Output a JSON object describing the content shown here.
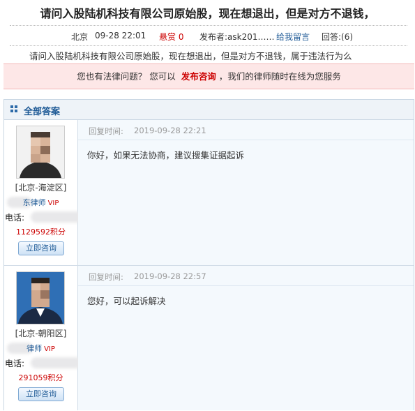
{
  "question": {
    "title": "请问入股陆机科技有限公司原始股，现在想退出，但是对方不退钱，",
    "location": "北京",
    "date": "09-28 22:01",
    "bounty": "悬赏 0",
    "publisher": "发布者:ask201……",
    "leave_message": "给我留言",
    "replies": "回答:(6)",
    "description": "请问入股陆机科技有限公司原始股，现在想退出，但是对方不退钱，属于违法行为么"
  },
  "banner": {
    "text_before": "您也有法律问题？  您可以",
    "action": "发布咨询",
    "text_after": "，我们的律师随时在线为您服务"
  },
  "answers_section": {
    "title": "全部答案",
    "items": [
      {
        "region": "[北京-海淀区]",
        "lawyer_suffix": "东律师",
        "vip": "VIP",
        "phone_label": "电话:",
        "points": "1129592积分",
        "consult_label": "立即咨询",
        "reply_label": "回复时间:",
        "reply_time": "2019-09-28 22:21",
        "reply_text": "你好，如果无法协商，建议搜集证据起诉"
      },
      {
        "region": "[北京-朝阳区]",
        "lawyer_suffix": "律师",
        "vip": "VIP",
        "phone_label": "电话:",
        "points": "291059积分",
        "consult_label": "立即咨询",
        "reply_label": "回复时间:",
        "reply_time": "2019-09-28 22:57",
        "reply_text": "您好，可以起诉解决"
      }
    ]
  },
  "colors": {
    "accent_red": "#cc0000",
    "link_blue": "#1e5a96",
    "banner_bg": "#fde7e7"
  }
}
